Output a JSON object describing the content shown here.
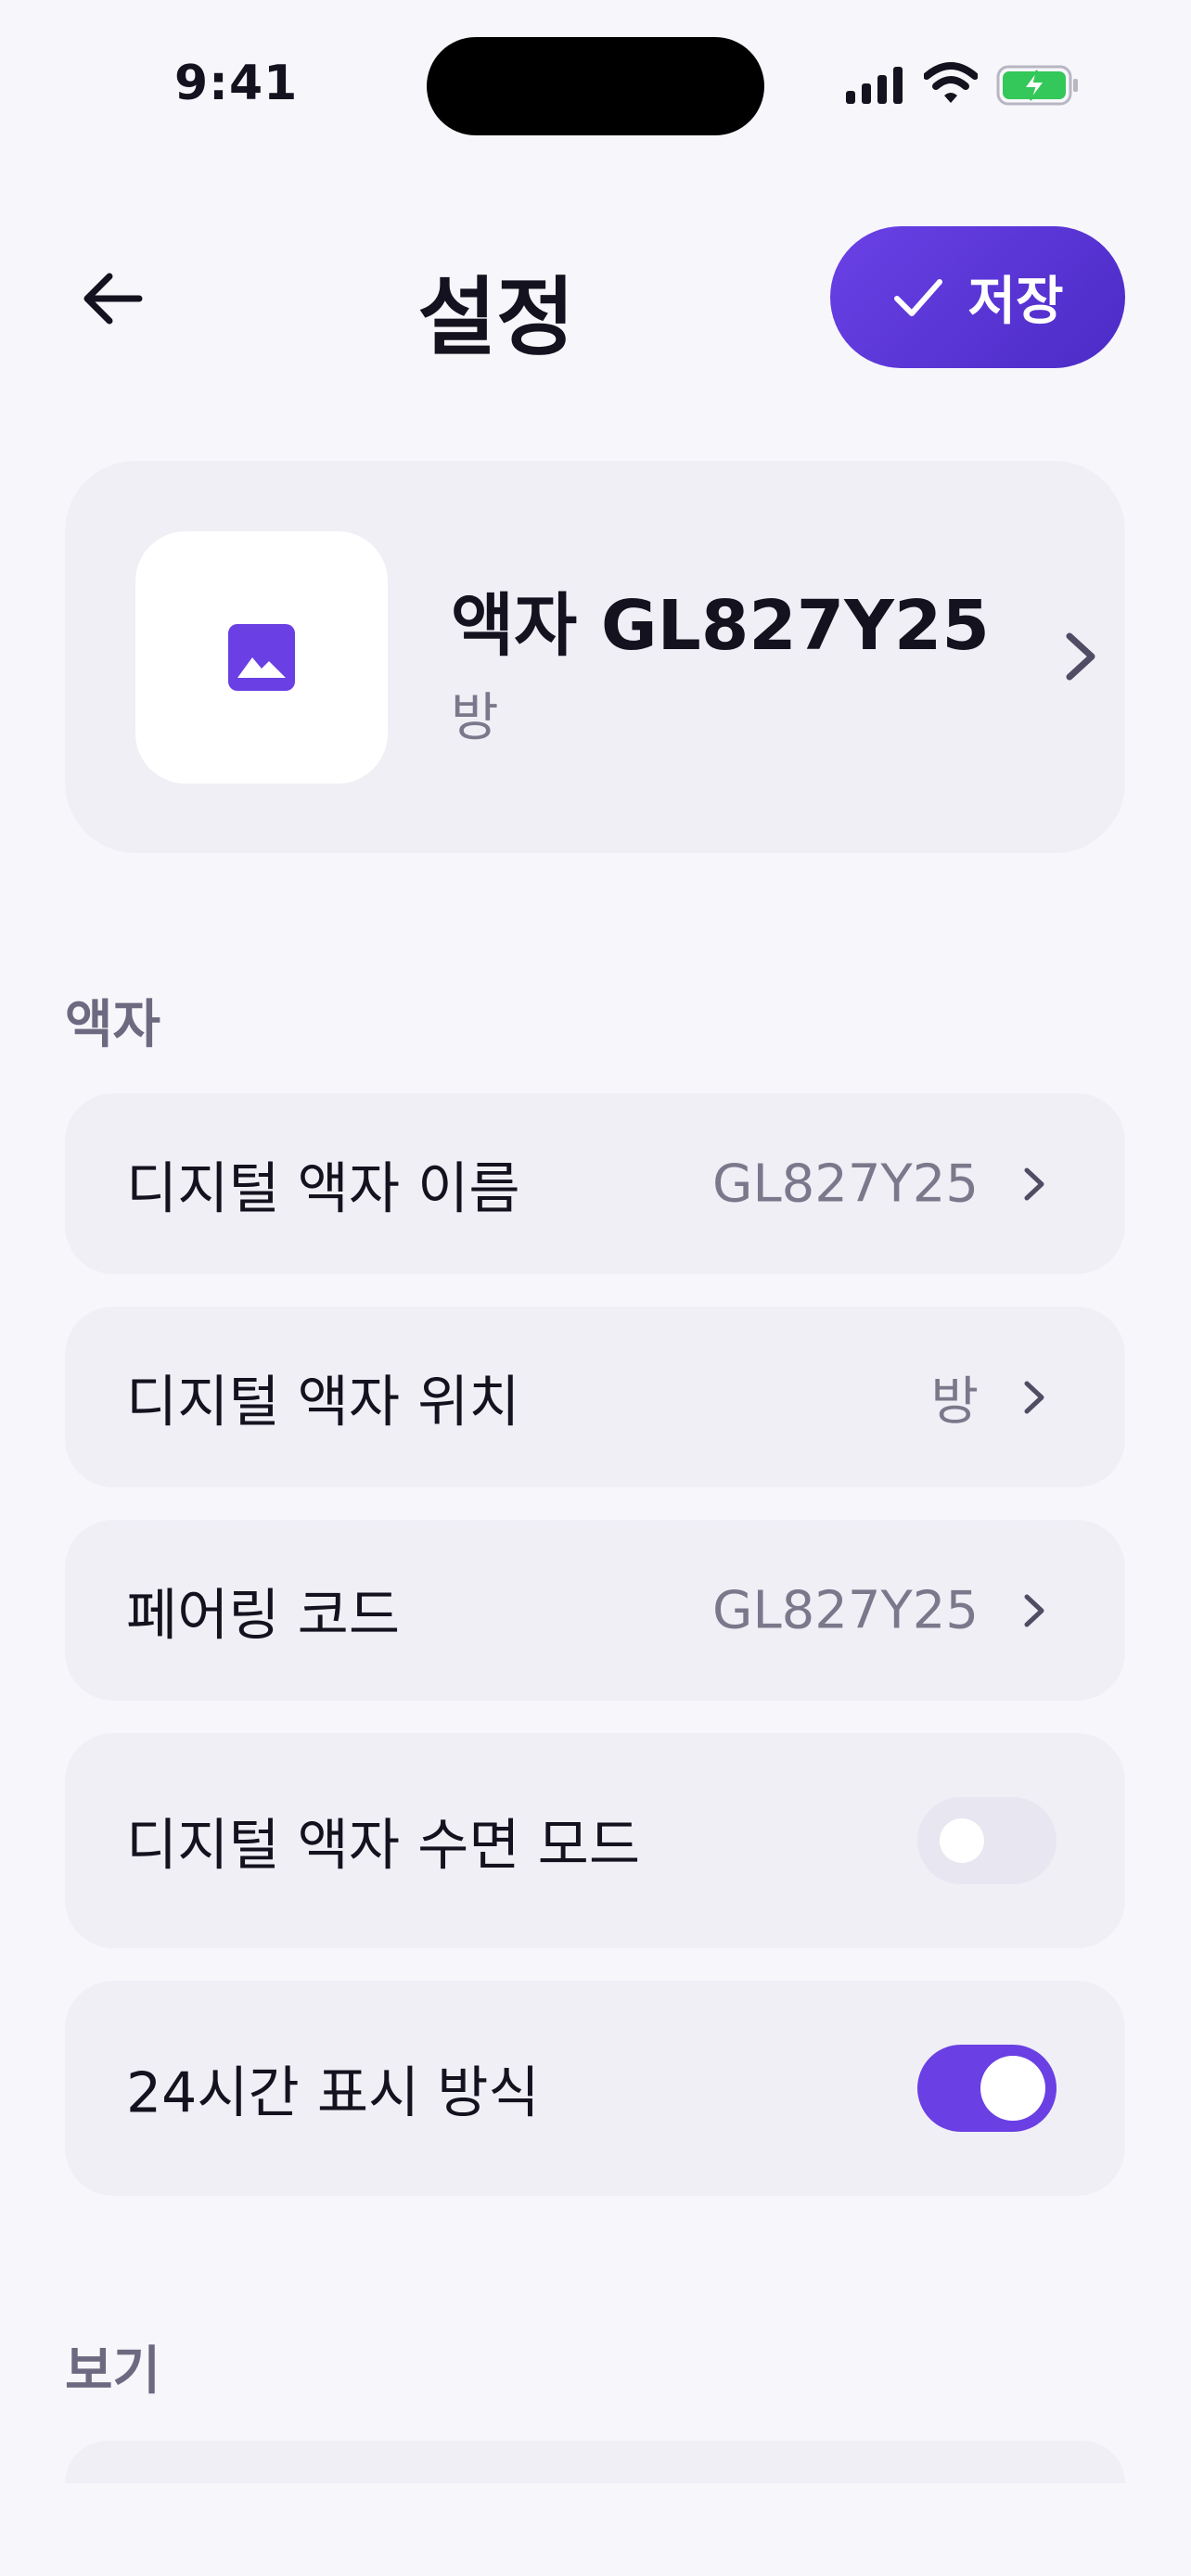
{
  "status_bar": {
    "time": "9:41"
  },
  "header": {
    "title": "설정",
    "save_label": "저장"
  },
  "device": {
    "name": "액자 GL827Y25",
    "location": "방"
  },
  "sections": [
    {
      "label": "액자"
    },
    {
      "label": "보기"
    }
  ],
  "rows": [
    {
      "label": "디지털 액자 이름",
      "value": "GL827Y25"
    },
    {
      "label": "디지털 액자 위치",
      "value": "방"
    },
    {
      "label": "페어링 코드",
      "value": "GL827Y25"
    },
    {
      "label": "디지털 액자 수면 모드",
      "toggle": false
    },
    {
      "label": "24시간 표시 방식",
      "toggle": true
    }
  ],
  "colors": {
    "accent": "#6A3FE3",
    "background": "#F7F7FB",
    "card": "#F0EFF6",
    "muted_text": "#7C788B"
  },
  "icons": [
    "back-arrow-icon",
    "checkmark-icon",
    "image-icon",
    "chevron-right-icon",
    "signal-icon",
    "wifi-icon",
    "battery-charging-icon"
  ]
}
